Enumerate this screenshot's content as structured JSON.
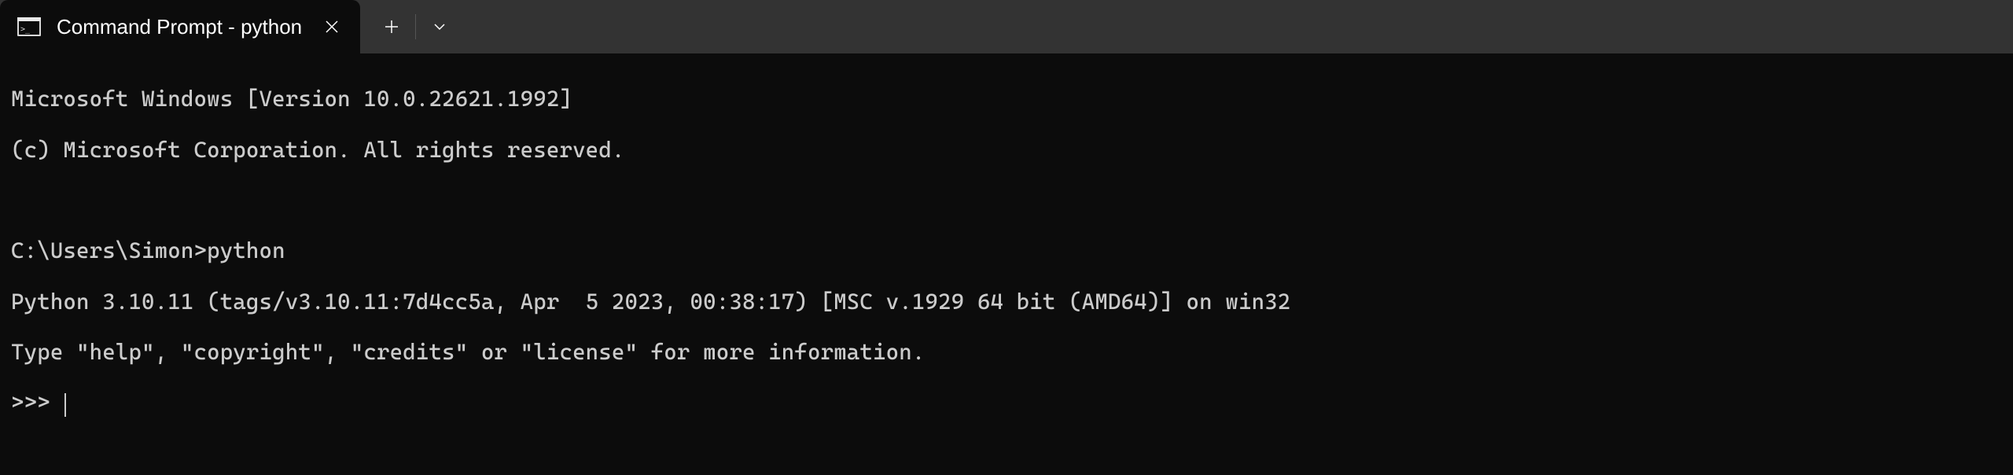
{
  "tab": {
    "title": "Command Prompt - python"
  },
  "terminal": {
    "line1": "Microsoft Windows [Version 10.0.22621.1992]",
    "line2": "(c) Microsoft Corporation. All rights reserved.",
    "line3": "",
    "line4": "C:\\Users\\Simon>python",
    "line5": "Python 3.10.11 (tags/v3.10.11:7d4cc5a, Apr  5 2023, 00:38:17) [MSC v.1929 64 bit (AMD64)] on win32",
    "line6": "Type \"help\", \"copyright\", \"credits\" or \"license\" for more information.",
    "line7": ">>> "
  }
}
